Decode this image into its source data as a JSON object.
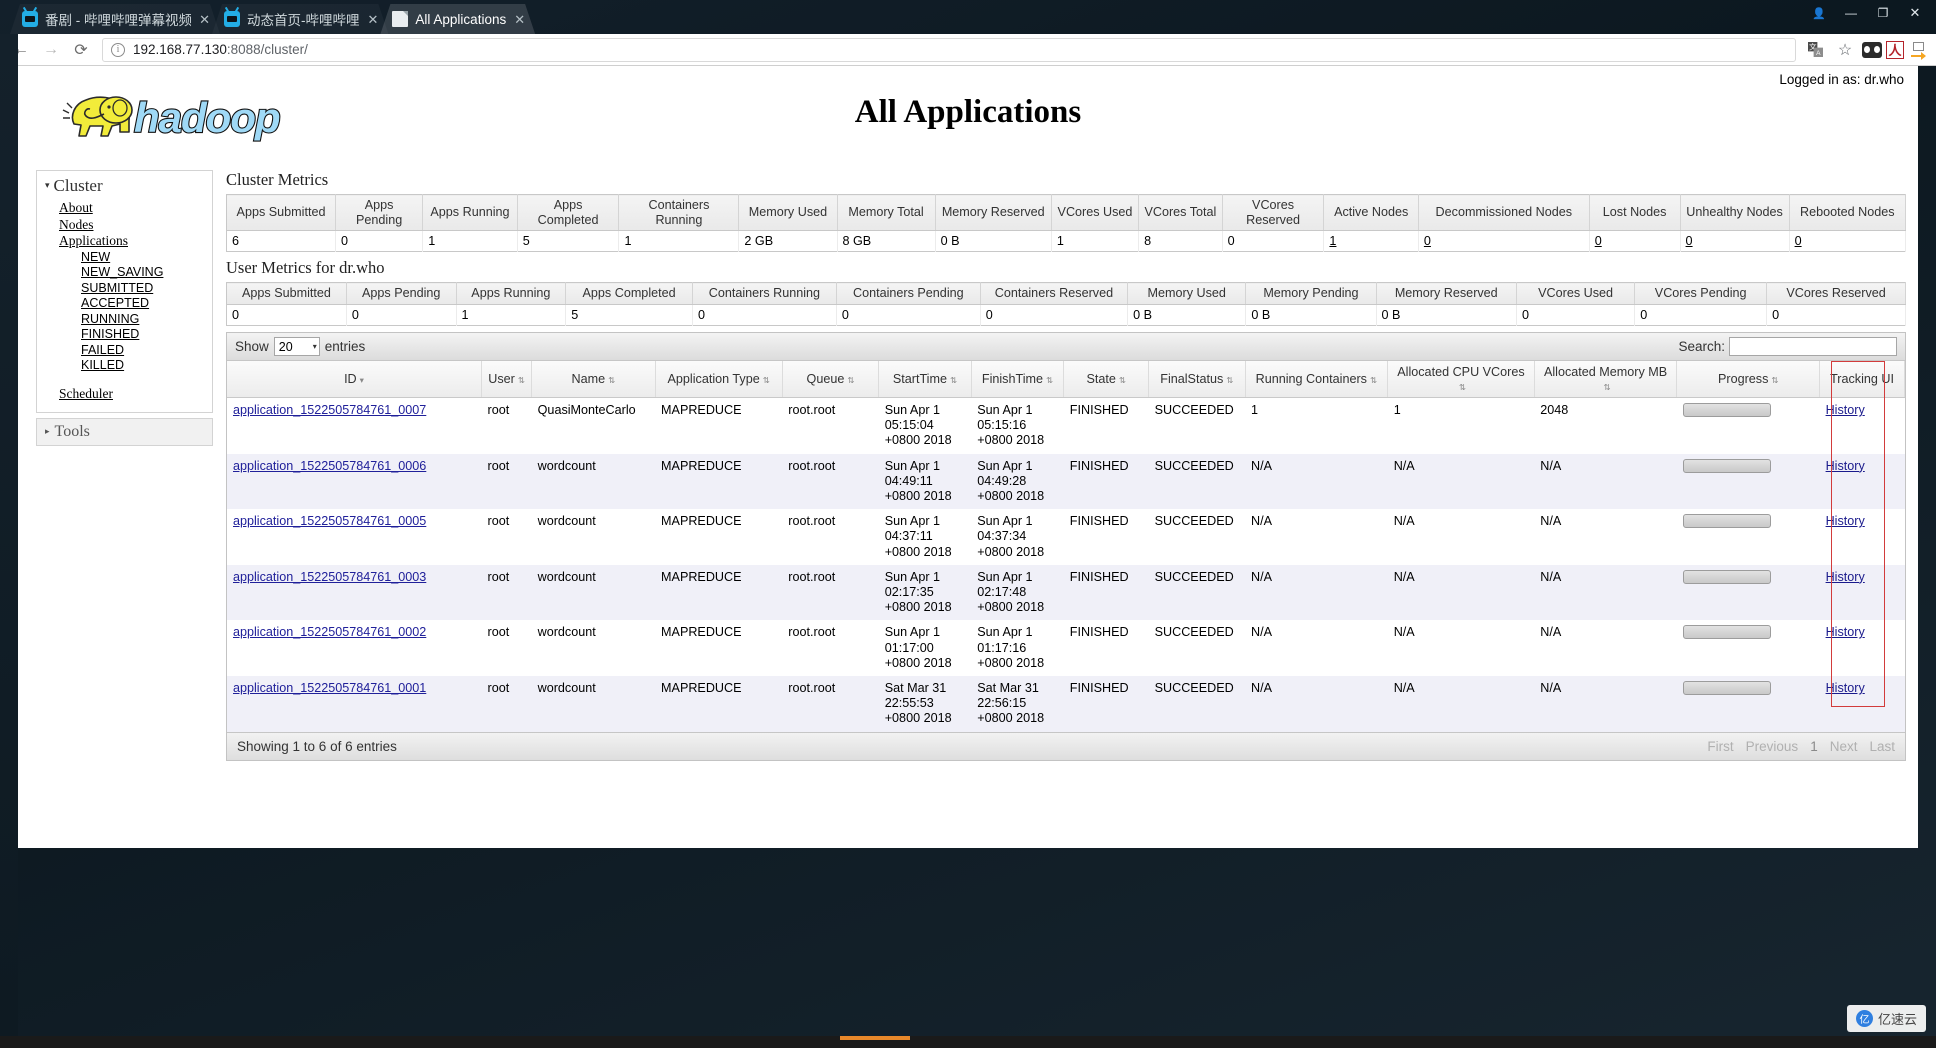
{
  "browser": {
    "tabs": [
      {
        "title": "番剧 - 哔哩哔哩弹幕视频",
        "favicon": "bilibili-icon",
        "active": false
      },
      {
        "title": "动态首页-哔哩哔哩",
        "favicon": "bilibili-icon",
        "active": false
      },
      {
        "title": "All Applications",
        "favicon": "document-icon",
        "active": true
      }
    ],
    "tab_close_label": "✕",
    "window_controls": {
      "profile": "👤",
      "minimize": "—",
      "maximize": "❐",
      "close": "✕"
    },
    "nav": {
      "back": "←",
      "forward": "→",
      "reload": "⟳"
    },
    "omnibox": {
      "info_icon": "i",
      "url_host": "192.168.77.130",
      "url_path": ":8088/cluster/"
    },
    "toolbar_icons": [
      "translate-icon",
      "bookmark-star-icon",
      "extension-icon",
      "pdf-icon",
      "download-icon"
    ]
  },
  "page": {
    "logged_in": "Logged in as: dr.who",
    "title": "All Applications",
    "logo_alt": "hadoop"
  },
  "sidebar": {
    "cluster": {
      "header": "Cluster",
      "caret": "▾",
      "links": [
        "About",
        "Nodes",
        "Applications"
      ],
      "app_states": [
        "NEW",
        "NEW_SAVING",
        "SUBMITTED",
        "ACCEPTED",
        "RUNNING",
        "FINISHED",
        "FAILED",
        "KILLED"
      ],
      "scheduler": "Scheduler"
    },
    "tools": {
      "header": "Tools",
      "caret": "▸"
    }
  },
  "cluster_metrics": {
    "title": "Cluster Metrics",
    "headers": [
      "Apps Submitted",
      "Apps Pending",
      "Apps Running",
      "Apps Completed",
      "Containers Running",
      "Memory Used",
      "Memory Total",
      "Memory Reserved",
      "VCores Used",
      "VCores Total",
      "VCores Reserved",
      "Active Nodes",
      "Decommissioned Nodes",
      "Lost Nodes",
      "Unhealthy Nodes",
      "Rebooted Nodes"
    ],
    "values": [
      "6",
      "0",
      "1",
      "5",
      "1",
      "2 GB",
      "8 GB",
      "0 B",
      "1",
      "8",
      "0",
      "1",
      "0",
      "0",
      "0",
      "0"
    ],
    "linked": [
      false,
      false,
      false,
      false,
      false,
      false,
      false,
      false,
      false,
      false,
      false,
      true,
      true,
      true,
      true,
      true
    ]
  },
  "user_metrics": {
    "title": "User Metrics for dr.who",
    "headers": [
      "Apps Submitted",
      "Apps Pending",
      "Apps Running",
      "Apps Completed",
      "Containers Running",
      "Containers Pending",
      "Containers Reserved",
      "Memory Used",
      "Memory Pending",
      "Memory Reserved",
      "VCores Used",
      "VCores Pending",
      "VCores Reserved"
    ],
    "values": [
      "0",
      "0",
      "1",
      "5",
      "0",
      "0",
      "0",
      "0 B",
      "0 B",
      "0 B",
      "0",
      "0",
      "0"
    ]
  },
  "datatable": {
    "show_label": "Show",
    "entries_label": "entries",
    "page_length": "20",
    "select_arrow": "▾",
    "search_label": "Search:",
    "search_value": "",
    "search_placeholder": "",
    "headers": [
      {
        "label": "ID",
        "sort": "▾"
      },
      {
        "label": "User",
        "sort": "⇅"
      },
      {
        "label": "Name",
        "sort": "⇅"
      },
      {
        "label": "Application Type",
        "sort": "⇅"
      },
      {
        "label": "Queue",
        "sort": "⇅"
      },
      {
        "label": "StartTime",
        "sort": "⇅"
      },
      {
        "label": "FinishTime",
        "sort": "⇅"
      },
      {
        "label": "State",
        "sort": "⇅"
      },
      {
        "label": "FinalStatus",
        "sort": "⇅"
      },
      {
        "label": "Running Containers",
        "sort": "⇅"
      },
      {
        "label": "Allocated CPU VCores",
        "sort": "⇅"
      },
      {
        "label": "Allocated Memory MB",
        "sort": "⇅"
      },
      {
        "label": "Progress",
        "sort": "⇅"
      },
      {
        "label": "Tracking UI",
        "sort": ""
      }
    ],
    "rows": [
      {
        "id": "application_1522505784761_0007",
        "user": "root",
        "name": "QuasiMonteCarlo",
        "type": "MAPREDUCE",
        "queue": "root.root",
        "start_time": "Sun Apr 1 05:15:04 +0800 2018",
        "finish_time": "Sun Apr 1 05:15:16 +0800 2018",
        "state": "FINISHED",
        "final_status": "SUCCEEDED",
        "running_containers": "1",
        "allocated_vcores": "1",
        "allocated_memory": "2048",
        "progress": "",
        "tracking_ui": "History"
      },
      {
        "id": "application_1522505784761_0006",
        "user": "root",
        "name": "wordcount",
        "type": "MAPREDUCE",
        "queue": "root.root",
        "start_time": "Sun Apr 1 04:49:11 +0800 2018",
        "finish_time": "Sun Apr 1 04:49:28 +0800 2018",
        "state": "FINISHED",
        "final_status": "SUCCEEDED",
        "running_containers": "N/A",
        "allocated_vcores": "N/A",
        "allocated_memory": "N/A",
        "progress": "",
        "tracking_ui": "History"
      },
      {
        "id": "application_1522505784761_0005",
        "user": "root",
        "name": "wordcount",
        "type": "MAPREDUCE",
        "queue": "root.root",
        "start_time": "Sun Apr 1 04:37:11 +0800 2018",
        "finish_time": "Sun Apr 1 04:37:34 +0800 2018",
        "state": "FINISHED",
        "final_status": "SUCCEEDED",
        "running_containers": "N/A",
        "allocated_vcores": "N/A",
        "allocated_memory": "N/A",
        "progress": "",
        "tracking_ui": "History"
      },
      {
        "id": "application_1522505784761_0003",
        "user": "root",
        "name": "wordcount",
        "type": "MAPREDUCE",
        "queue": "root.root",
        "start_time": "Sun Apr 1 02:17:35 +0800 2018",
        "finish_time": "Sun Apr 1 02:17:48 +0800 2018",
        "state": "FINISHED",
        "final_status": "SUCCEEDED",
        "running_containers": "N/A",
        "allocated_vcores": "N/A",
        "allocated_memory": "N/A",
        "progress": "",
        "tracking_ui": "History"
      },
      {
        "id": "application_1522505784761_0002",
        "user": "root",
        "name": "wordcount",
        "type": "MAPREDUCE",
        "queue": "root.root",
        "start_time": "Sun Apr 1 01:17:00 +0800 2018",
        "finish_time": "Sun Apr 1 01:17:16 +0800 2018",
        "state": "FINISHED",
        "final_status": "SUCCEEDED",
        "running_containers": "N/A",
        "allocated_vcores": "N/A",
        "allocated_memory": "N/A",
        "progress": "",
        "tracking_ui": "History"
      },
      {
        "id": "application_1522505784761_0001",
        "user": "root",
        "name": "wordcount",
        "type": "MAPREDUCE",
        "queue": "root.root",
        "start_time": "Sat Mar 31 22:55:53 +0800 2018",
        "finish_time": "Sat Mar 31 22:56:15 +0800 2018",
        "state": "FINISHED",
        "final_status": "SUCCEEDED",
        "running_containers": "N/A",
        "allocated_vcores": "N/A",
        "allocated_memory": "N/A",
        "progress": "",
        "tracking_ui": "History"
      }
    ],
    "info": "Showing 1 to 6 of 6 entries",
    "pagination": [
      "First",
      "Previous",
      "1",
      "Next",
      "Last"
    ],
    "highlight_color": "#d23b3b"
  },
  "watermark": {
    "text": "亿速云",
    "logo": "亿"
  }
}
